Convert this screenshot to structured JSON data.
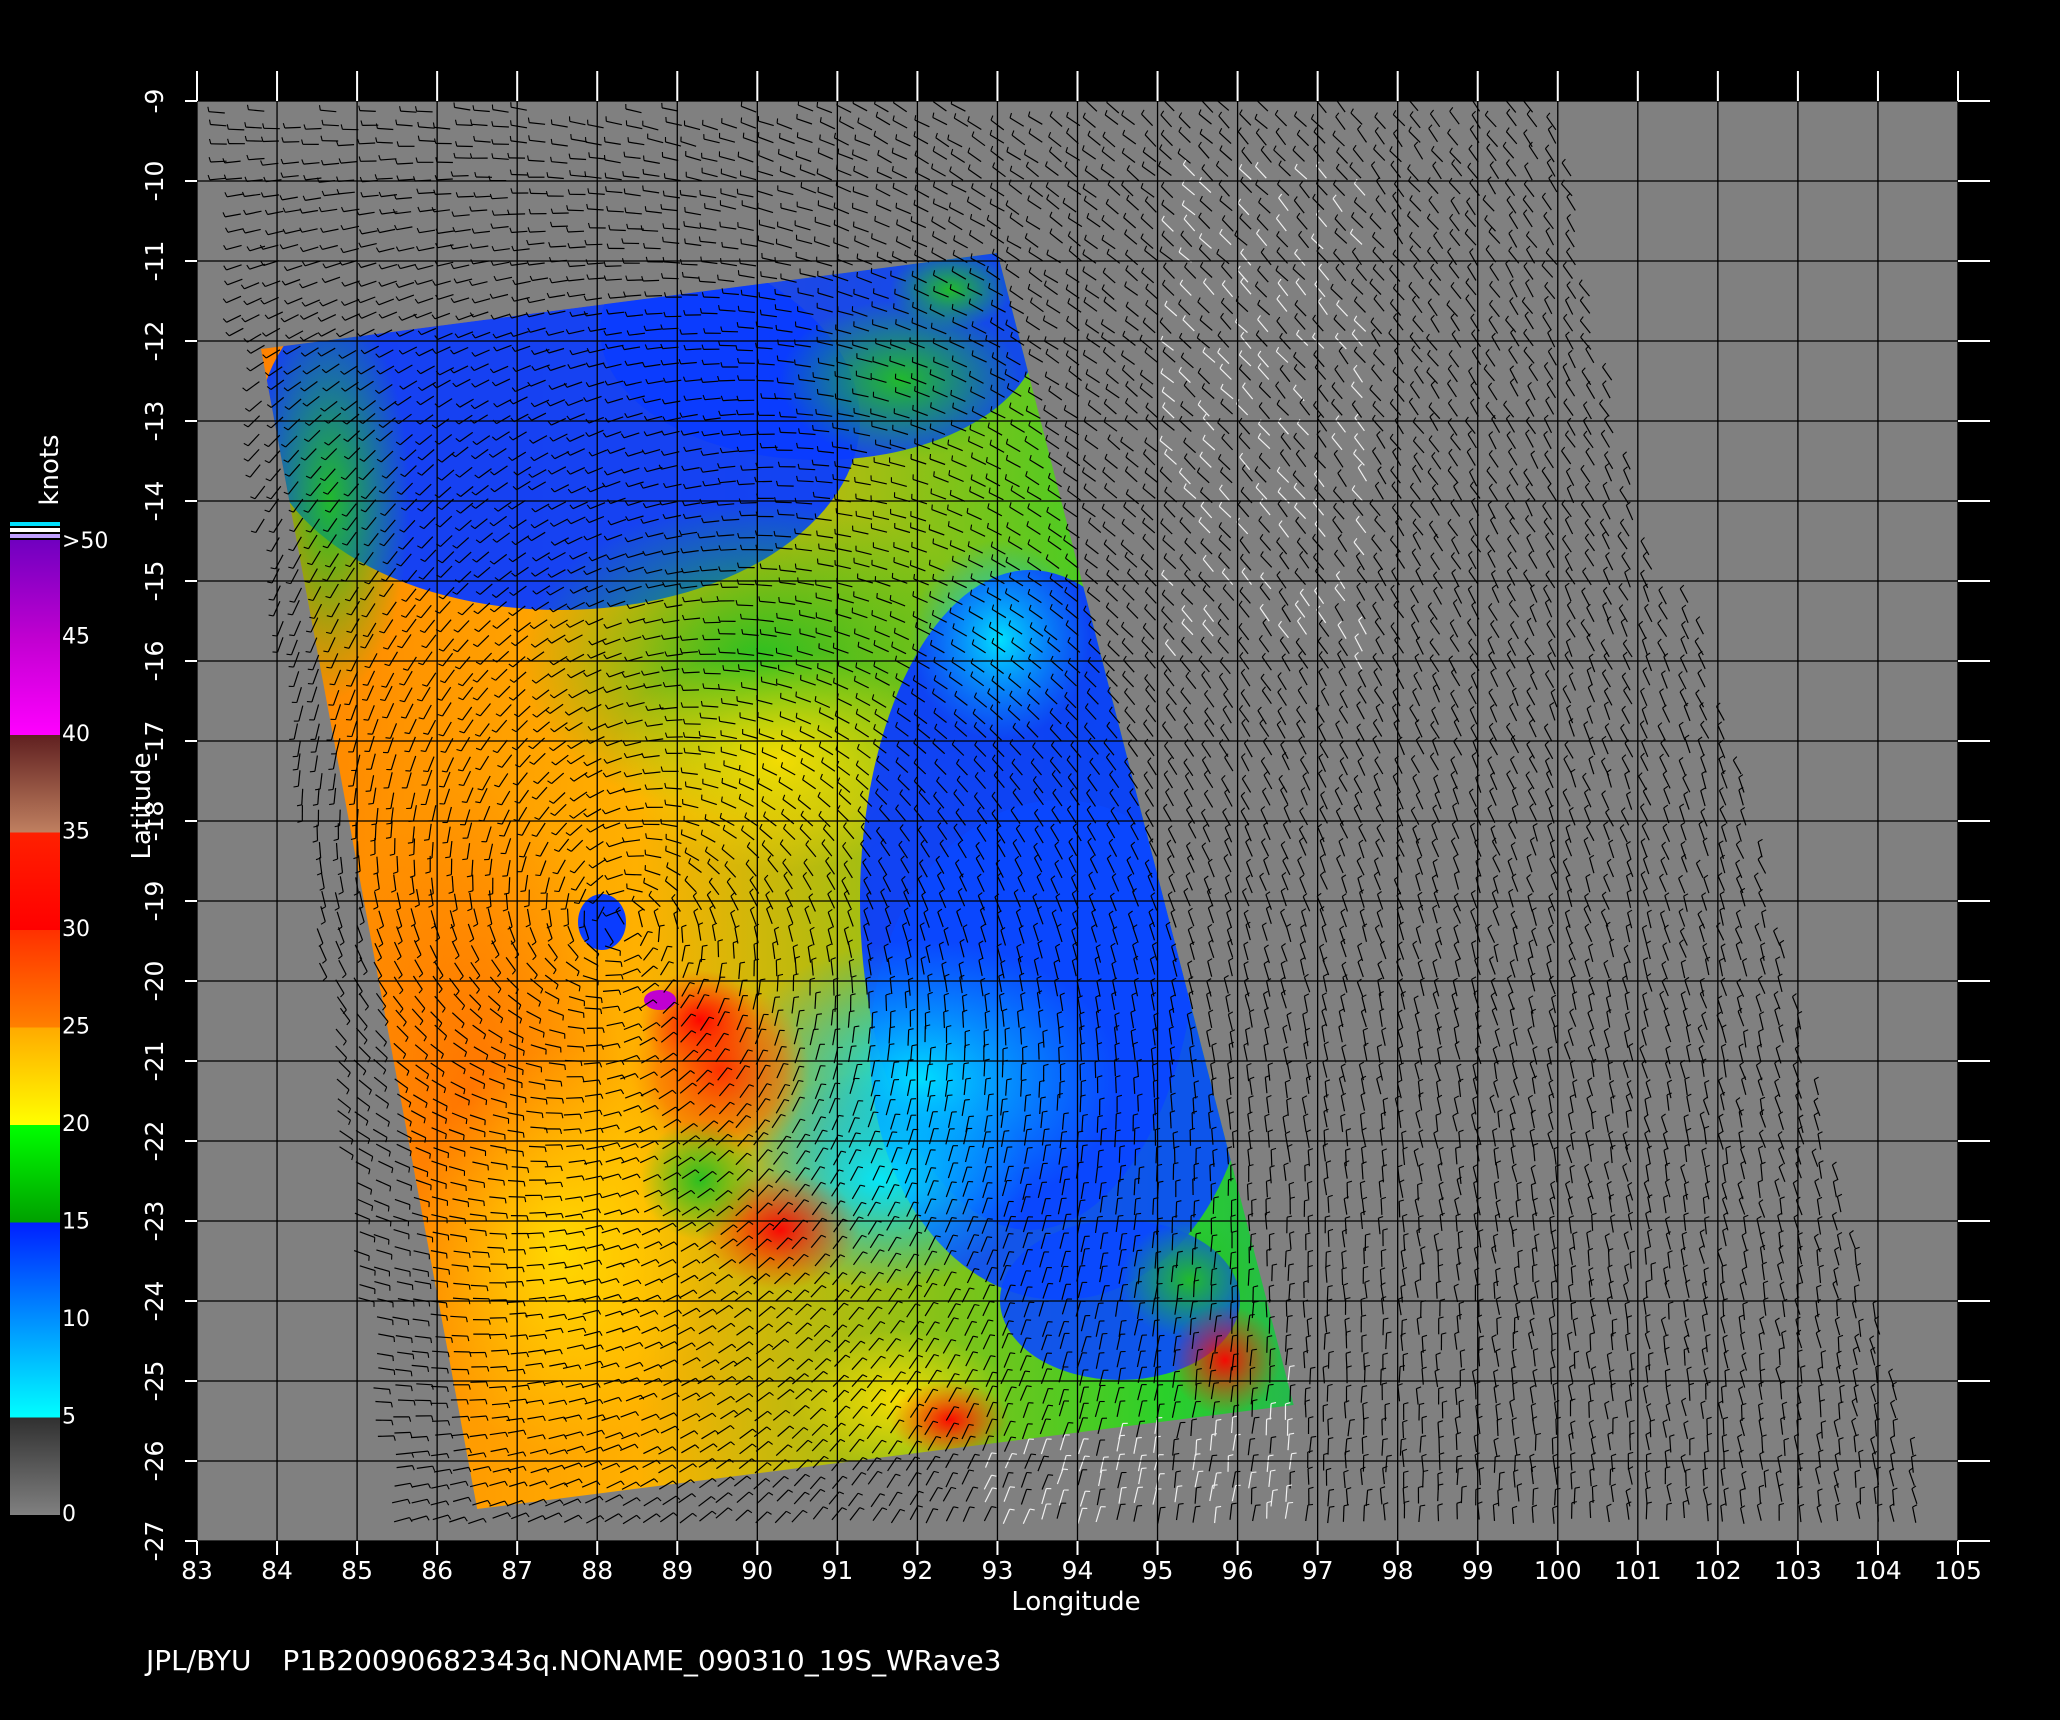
{
  "map": {
    "y_axis_label": "Latitude",
    "x_axis_label": "Longitude",
    "lon_range": [
      83,
      105
    ],
    "lat_range": [
      -27,
      -9
    ],
    "lon_ticks": [
      "83",
      "84",
      "85",
      "86",
      "87",
      "88",
      "89",
      "90",
      "91",
      "92",
      "93",
      "94",
      "95",
      "96",
      "97",
      "98",
      "99",
      "100",
      "101",
      "102",
      "103",
      "104",
      "105"
    ],
    "lat_ticks": [
      "-9",
      "-10",
      "-11",
      "-12",
      "-13",
      "-14",
      "-15",
      "-16",
      "-17",
      "-18",
      "-19",
      "-20",
      "-21",
      "-22",
      "-23",
      "-24",
      "-25",
      "-26",
      "-27"
    ],
    "background_color": "#808080",
    "grid": true,
    "wind_barbs": true,
    "swath_corners_lon_lat": [
      [
        83.8,
        -12.1
      ],
      [
        93.0,
        -10.9
      ],
      [
        96.7,
        -25.3
      ],
      [
        86.5,
        -26.6
      ]
    ],
    "storm_center_lon_lat": [
      88.3,
      -19.3
    ]
  },
  "colorbar": {
    "label": "knots",
    "tick_labels": [
      ">50",
      "45",
      "40",
      "35",
      "30",
      "25",
      "20",
      "15",
      "10",
      "5",
      "0"
    ],
    "stops": [
      {
        "value": 0,
        "color": "#808080"
      },
      {
        "value": 5,
        "color": "#303030"
      },
      {
        "value": 5,
        "color": "#00ffff"
      },
      {
        "value": 10,
        "color": "#0090ff"
      },
      {
        "value": 15,
        "color": "#0020ff"
      },
      {
        "value": 15,
        "color": "#00a000"
      },
      {
        "value": 20,
        "color": "#00ff00"
      },
      {
        "value": 20,
        "color": "#ffff00"
      },
      {
        "value": 25,
        "color": "#ffaa00"
      },
      {
        "value": 25,
        "color": "#ff8000"
      },
      {
        "value": 30,
        "color": "#ff3000"
      },
      {
        "value": 30,
        "color": "#ff0000"
      },
      {
        "value": 35,
        "color": "#ff2000"
      },
      {
        "value": 35,
        "color": "#c08060"
      },
      {
        "value": 40,
        "color": "#602020"
      },
      {
        "value": 40,
        "color": "#ff00ff"
      },
      {
        "value": 45,
        "color": "#c000d0"
      },
      {
        "value": 50,
        "color": "#7000c0"
      }
    ]
  },
  "footer": {
    "source": "JPL/BYU",
    "filename": "P1B20090682343q.NONAME_090310_19S_WRave3"
  }
}
